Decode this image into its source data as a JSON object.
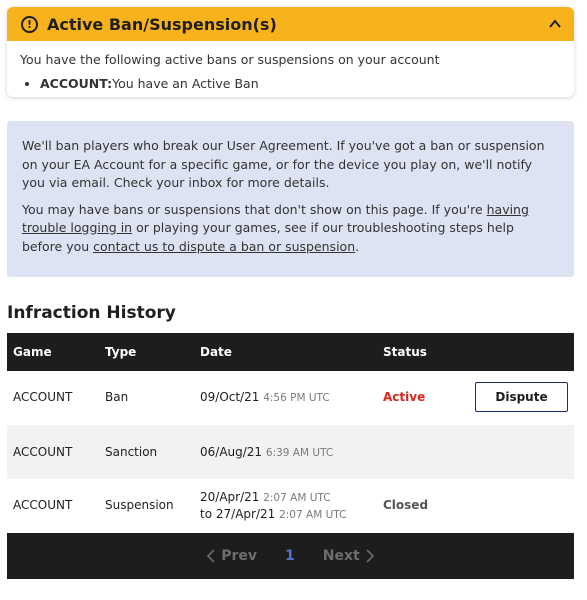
{
  "alert": {
    "icon": "exclamation-circle-icon",
    "title": "Active Ban/Suspension(s)",
    "message": "You have the following active bans or suspensions on your account",
    "items": [
      {
        "label": "ACCOUNT:",
        "text": "You have an Active Ban"
      }
    ],
    "header_color": "#f8b21b"
  },
  "info": {
    "p1": "We'll ban players who break our User Agreement. If you've got a ban or suspension on your EA Account for a specific game, or for the device you play on, we'll notify you via email. Check your inbox for more details.",
    "p2_before": "You may have bans or suspensions that don't show on this page. If you're ",
    "p2_link1": "having trouble logging in",
    "p2_mid": " or playing your games, see if our troubleshooting steps help before you ",
    "p2_link2": "contact us to dispute a ban or suspension",
    "p2_after": "."
  },
  "history": {
    "title": "Infraction History",
    "columns": [
      "Game",
      "Type",
      "Date",
      "Status"
    ],
    "rows": [
      {
        "game": "ACCOUNT",
        "type": "Ban",
        "date": "09/Oct/21",
        "time": "4:56 PM UTC",
        "status": "Active",
        "action": "Dispute"
      },
      {
        "game": "ACCOUNT",
        "type": "Sanction",
        "date": "06/Aug/21",
        "time": "6:39 AM UTC",
        "status": ""
      },
      {
        "game": "ACCOUNT",
        "type": "Suspension",
        "date": "20/Apr/21",
        "time": "2:07 AM UTC",
        "date2_prefix": "to",
        "date2": "27/Apr/21",
        "time2": "2:07 AM UTC",
        "status": "Closed"
      }
    ]
  },
  "pager": {
    "prev": "Prev",
    "page": "1",
    "next": "Next"
  },
  "colors": {
    "active": "#d9261c",
    "accent": "#5b6ed8",
    "info_bg": "#dde3f2"
  }
}
